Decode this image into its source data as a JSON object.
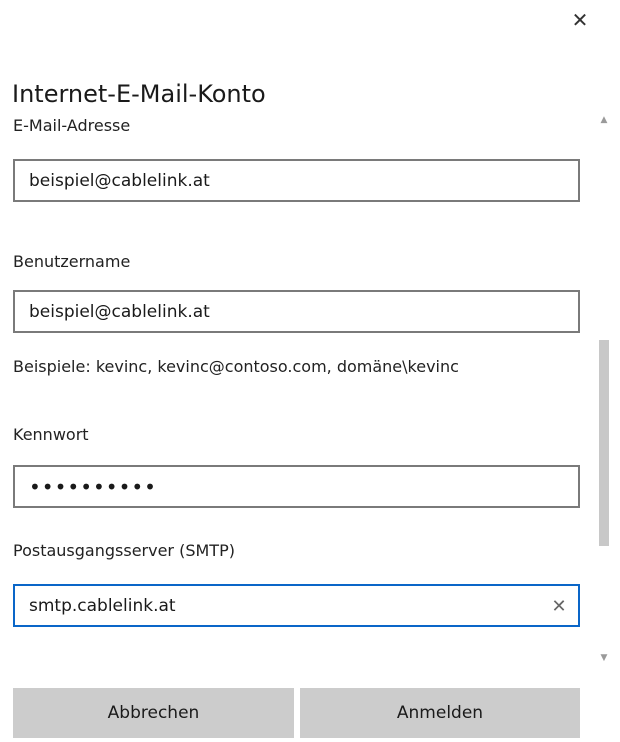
{
  "dialog": {
    "title": "Internet-E-Mail-Konto",
    "close_glyph": "✕"
  },
  "fields": {
    "email": {
      "label": "E-Mail-Adresse",
      "value": "beispiel@cablelink.at"
    },
    "username": {
      "label": "Benutzername",
      "value": "beispiel@cablelink.at",
      "hint": "Beispiele: kevinc, kevinc@contoso.com, domäne\\kevinc"
    },
    "password": {
      "label": "Kennwort",
      "value": "••••••••••"
    },
    "smtp": {
      "label": "Postausgangsserver (SMTP)",
      "value": "smtp.cablelink.at",
      "clear_glyph": "✕"
    }
  },
  "scrollbar": {
    "up_glyph": "▲",
    "down_glyph": "▼"
  },
  "buttons": {
    "cancel": "Abbrechen",
    "signin": "Anmelden"
  },
  "colors": {
    "focus_border": "#0a66c8",
    "input_border": "#7a7a7a",
    "button_bg": "#cccccc",
    "scroll_thumb": "#c8c8c8"
  }
}
